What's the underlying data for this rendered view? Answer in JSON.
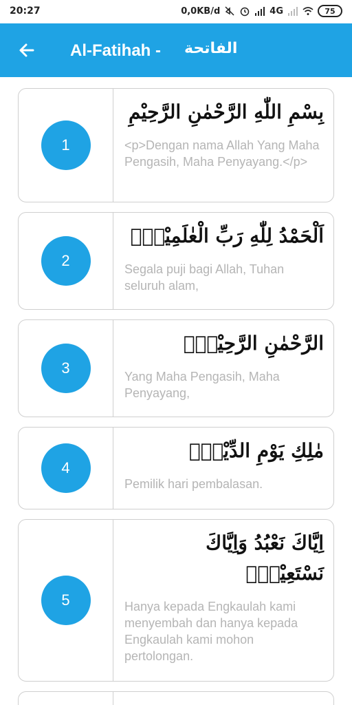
{
  "status_bar": {
    "time": "20:27",
    "speed": "0,0KB/d",
    "network": "4G",
    "battery": "75"
  },
  "app_bar": {
    "title": "Al-Fatihah -",
    "title_arabic": "الفاتحة",
    "color": "#1fa3e4"
  },
  "verses": [
    {
      "number": "1",
      "arabic": "بِسْمِ اللّٰهِ الرَّحْمٰنِ الرَّحِيْمِ",
      "translation": "<p>Dengan nama Allah Yang Maha Pengasih, Maha Penyayang.</p>"
    },
    {
      "number": "2",
      "arabic": "اَلْحَمْدُ لِلّٰهِ رَبِّ الْعٰلَمِيْنَۙ",
      "translation": "Segala puji bagi Allah, Tuhan seluruh alam,"
    },
    {
      "number": "3",
      "arabic": "الرَّحْمٰنِ الرَّحِيْمِۙ",
      "translation": "Yang Maha Pengasih, Maha Penyayang,"
    },
    {
      "number": "4",
      "arabic": "مٰلِكِ يَوْمِ الدِّيْنِۗ",
      "translation": "Pemilik hari pembalasan."
    },
    {
      "number": "5",
      "arabic": "اِيَّاكَ نَعْبُدُ وَاِيَّاكَ نَسْتَعِيْنُۗ",
      "translation": "Hanya kepada Engkaulah kami menyembah dan hanya kepada Engkaulah kami mohon pertolongan."
    }
  ]
}
